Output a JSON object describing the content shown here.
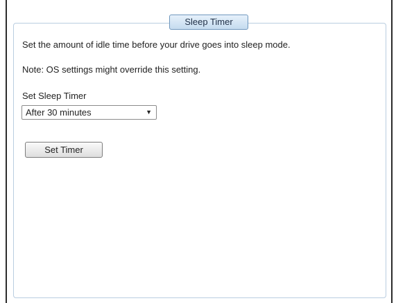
{
  "panel": {
    "tab_label": "Sleep Timer",
    "description": "Set the amount of idle time before your drive goes into sleep mode.",
    "note": "Note: OS settings might override this setting.",
    "timer_label": "Set Sleep Timer",
    "timer_select": {
      "selected": "After 30 minutes",
      "arrow_icon": "dropdown-arrow-icon"
    },
    "set_button_label": "Set Timer"
  }
}
